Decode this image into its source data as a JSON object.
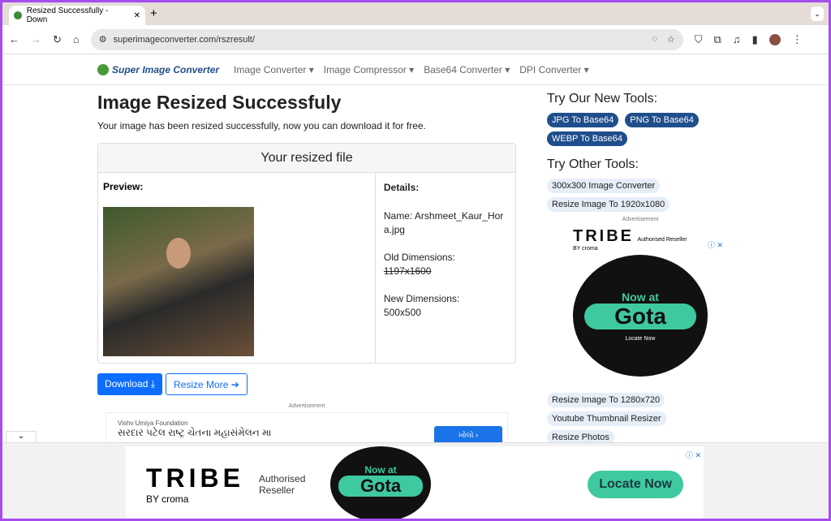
{
  "browser": {
    "tab_title": "Resized Successfully - Down",
    "url": "superimageconverter.com/rszresult/"
  },
  "nav": {
    "logo": "Super Image Converter",
    "items": [
      "Image Converter ▾",
      "Image Compressor ▾",
      "Base64 Converter ▾",
      "DPI Converter ▾"
    ]
  },
  "main": {
    "title": "Image Resized Successfuly",
    "subtitle": "Your image has been resized successfully, now you can download it for free.",
    "card_title": "Your resized file",
    "preview_label": "Preview:",
    "details_label": "Details:",
    "name": "Name: Arshmeet_Kaur_Hora.jpg",
    "old_dims_label": "Old Dimensions:",
    "old_dims": "1197x1600",
    "new_dims_label": "New Dimensions:",
    "new_dims": "500x500",
    "download": "Download ⤓",
    "resize_more": "Resize More ➔"
  },
  "ad_inline": {
    "label": "Advertisement",
    "sponsor": "Vishv Umiya Foundation",
    "headline": "સરદાર પટેલ રાષ્ટ્ર ચેતના મહાસંમેલન મા",
    "button": "ખોલો ›"
  },
  "sidebar": {
    "new_tools_title": "Try Our New Tools:",
    "new_tools": [
      "JPG To Base64",
      "PNG To Base64",
      "WEBP To Base64"
    ],
    "other_tools_title": "Try Other Tools:",
    "other_tools": [
      "300x300 Image Converter",
      "Resize Image To 1920x1080"
    ],
    "ad_label": "Advertisement",
    "more_tools": [
      "Resize Image To 1280x720",
      "Youtube Thumbnail Resizer",
      "Resize Photos"
    ]
  },
  "ads": {
    "brand": "TRIBE",
    "by": "BY croma",
    "reseller": "Authorised Reseller",
    "now_at": "Now at",
    "gota": "Gota",
    "locate": "Locate Now"
  }
}
